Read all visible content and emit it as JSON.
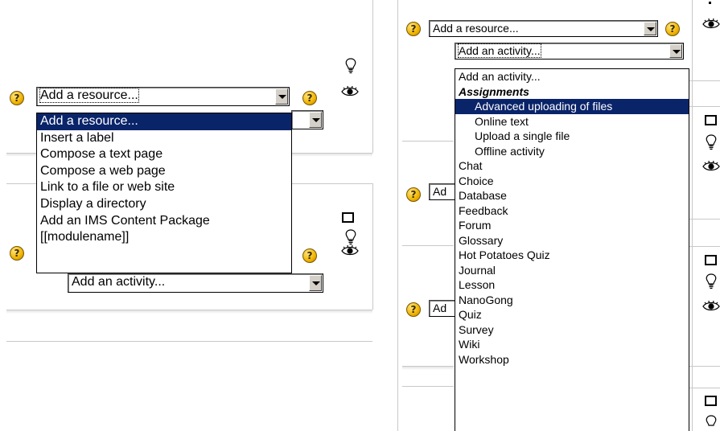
{
  "left_panel": {
    "resource_select": {
      "value": "Add a resource..."
    },
    "activity_select_behind": {
      "value": "Add an activity..."
    },
    "resource_dropdown": {
      "items": [
        "Add a resource...",
        "Insert a label",
        "Compose a text page",
        "Compose a web page",
        "Link to a file or web site",
        "Display a directory",
        "Add an IMS Content Package",
        "[[modulename]]"
      ],
      "selected_index": 0
    }
  },
  "right_panel": {
    "resource_select": {
      "value": "Add a resource..."
    },
    "activity_select": {
      "value": "Add an activity..."
    },
    "partial_select_label": "Ad",
    "activity_dropdown": {
      "items": [
        {
          "label": "Add an activity...",
          "kind": "option"
        },
        {
          "label": "Assignments",
          "kind": "group"
        },
        {
          "label": "Advanced uploading of files",
          "kind": "suboption",
          "selected": true
        },
        {
          "label": "Online text",
          "kind": "suboption"
        },
        {
          "label": "Upload a single file",
          "kind": "suboption"
        },
        {
          "label": "Offline activity",
          "kind": "suboption"
        },
        {
          "label": "Chat",
          "kind": "option"
        },
        {
          "label": "Choice",
          "kind": "option"
        },
        {
          "label": "Database",
          "kind": "option"
        },
        {
          "label": "Feedback",
          "kind": "option"
        },
        {
          "label": "Forum",
          "kind": "option"
        },
        {
          "label": "Glossary",
          "kind": "option"
        },
        {
          "label": "Hot Potatoes Quiz",
          "kind": "option"
        },
        {
          "label": "Journal",
          "kind": "option"
        },
        {
          "label": "Lesson",
          "kind": "option"
        },
        {
          "label": "NanoGong",
          "kind": "option"
        },
        {
          "label": "Quiz",
          "kind": "option"
        },
        {
          "label": "Survey",
          "kind": "option"
        },
        {
          "label": "Wiki",
          "kind": "option"
        },
        {
          "label": "Workshop",
          "kind": "option"
        }
      ]
    }
  },
  "icons": {
    "help": "help-icon",
    "bulb": "lightbulb-icon",
    "eye": "eye-icon",
    "checkbox": "checkbox-icon"
  },
  "colors": {
    "selection": "#0a246a",
    "selection_text": "#ffffff",
    "help_icon": "#f0b400"
  }
}
